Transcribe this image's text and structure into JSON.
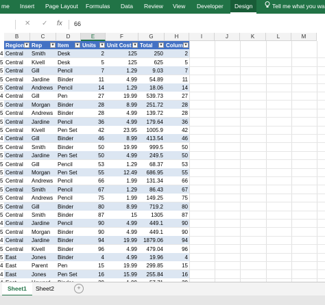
{
  "ribbon": {
    "tabs": [
      "me",
      "Insert",
      "Page Layout",
      "Formulas",
      "Data",
      "Review",
      "View",
      "Developer",
      "Design"
    ],
    "active_tab": "Design",
    "tell_me": "Tell me what you wa"
  },
  "formula_bar": {
    "cancel_glyph": "✕",
    "enter_glyph": "✓",
    "fx_label": "fx",
    "value": "66"
  },
  "columns": [
    "B",
    "C",
    "D",
    "E",
    "F",
    "G",
    "H",
    "I",
    "J",
    "K",
    "L",
    "M"
  ],
  "table": {
    "headers": [
      "Region",
      "Rep",
      "Item",
      "Units",
      "Unit Cost",
      "Total",
      "Column"
    ],
    "rows": [
      [
        "4",
        "Central",
        "Smith",
        "Desk",
        "2",
        "125",
        "250",
        "2"
      ],
      [
        "5",
        "Central",
        "Kivell",
        "Desk",
        "5",
        "125",
        "625",
        "5"
      ],
      [
        "5",
        "Central",
        "Gill",
        "Pencil",
        "7",
        "1.29",
        "9.03",
        "7"
      ],
      [
        "5",
        "Central",
        "Jardine",
        "Binder",
        "11",
        "4.99",
        "54.89",
        "11"
      ],
      [
        "5",
        "Central",
        "Andrews",
        "Pencil",
        "14",
        "1.29",
        "18.06",
        "14"
      ],
      [
        "4",
        "Central",
        "Gill",
        "Pen",
        "27",
        "19.99",
        "539.73",
        "27"
      ],
      [
        "5",
        "Central",
        "Morgan",
        "Binder",
        "28",
        "8.99",
        "251.72",
        "28"
      ],
      [
        "5",
        "Central",
        "Andrews",
        "Binder",
        "28",
        "4.99",
        "139.72",
        "28"
      ],
      [
        "5",
        "Central",
        "Jardine",
        "Pencil",
        "36",
        "4.99",
        "179.64",
        "36"
      ],
      [
        "5",
        "Central",
        "Kivell",
        "Pen Set",
        "42",
        "23.95",
        "1005.9",
        "42"
      ],
      [
        "4",
        "Central",
        "Gill",
        "Binder",
        "46",
        "8.99",
        "413.54",
        "46"
      ],
      [
        "5",
        "Central",
        "Smith",
        "Binder",
        "50",
        "19.99",
        "999.5",
        "50"
      ],
      [
        "5",
        "Central",
        "Jardine",
        "Pen Set",
        "50",
        "4.99",
        "249.5",
        "50"
      ],
      [
        "5",
        "Central",
        "Gill",
        "Pencil",
        "53",
        "1.29",
        "68.37",
        "53"
      ],
      [
        "5",
        "Central",
        "Morgan",
        "Pen Set",
        "55",
        "12.49",
        "686.95",
        "55"
      ],
      [
        "5",
        "Central",
        "Andrews",
        "Pencil",
        "66",
        "1.99",
        "131.34",
        "66"
      ],
      [
        "5",
        "Central",
        "Smith",
        "Pencil",
        "67",
        "1.29",
        "86.43",
        "67"
      ],
      [
        "5",
        "Central",
        "Andrews",
        "Pencil",
        "75",
        "1.99",
        "149.25",
        "75"
      ],
      [
        "5",
        "Central",
        "Gill",
        "Binder",
        "80",
        "8.99",
        "719.2",
        "80"
      ],
      [
        "5",
        "Central",
        "Smith",
        "Binder",
        "87",
        "15",
        "1305",
        "87"
      ],
      [
        "4",
        "Central",
        "Jardine",
        "Pencil",
        "90",
        "4.99",
        "449.1",
        "90"
      ],
      [
        "5",
        "Central",
        "Morgan",
        "Binder",
        "90",
        "4.99",
        "449.1",
        "90"
      ],
      [
        "4",
        "Central",
        "Jardine",
        "Binder",
        "94",
        "19.99",
        "1879.06",
        "94"
      ],
      [
        "5",
        "Central",
        "Kivell",
        "Binder",
        "96",
        "4.99",
        "479.04",
        "96"
      ],
      [
        "5",
        "East",
        "Jones",
        "Binder",
        "4",
        "4.99",
        "19.96",
        "4"
      ],
      [
        "4",
        "East",
        "Parent",
        "Pen",
        "15",
        "19.99",
        "299.85",
        "15"
      ],
      [
        "4",
        "East",
        "Jones",
        "Pen Set",
        "16",
        "15.99",
        "255.84",
        "16"
      ],
      [
        "4",
        "East",
        "Howard",
        "Binder",
        "29",
        "1.99",
        "57.71",
        "29"
      ],
      [
        "5",
        "East",
        "Jones",
        "Pencil",
        "35",
        "4.99",
        "174.65",
        "35"
      ],
      [
        "4",
        "East",
        "Jones",
        "Binder",
        "",
        "",
        "",
        ""
      ]
    ]
  },
  "sheets": {
    "tabs": [
      "Sheet1",
      "Sheet2"
    ],
    "add_glyph": "+"
  },
  "colors": {
    "ribbon": "#217346",
    "table_header": "#4472c4",
    "band": "#dce6f2"
  }
}
